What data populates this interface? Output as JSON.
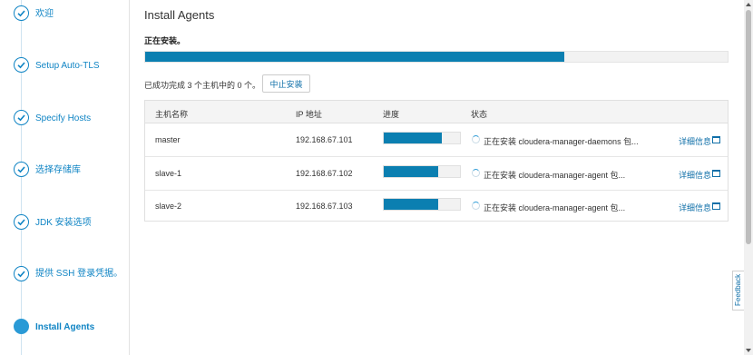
{
  "wizard": {
    "steps": [
      {
        "label": "欢迎",
        "state": "done"
      },
      {
        "label": "Setup Auto-TLS",
        "state": "done"
      },
      {
        "label": "Specify Hosts",
        "state": "done"
      },
      {
        "label": "选择存储库",
        "state": "done"
      },
      {
        "label": "JDK 安装选项",
        "state": "done"
      },
      {
        "label": "提供 SSH 登录凭据。",
        "state": "done"
      },
      {
        "label": "Install Agents",
        "state": "current"
      }
    ]
  },
  "main": {
    "title": "Install Agents",
    "status": "正在安装。",
    "overall_progress_fraction": 0.72,
    "summary": "已成功完成 3 个主机中的 0 个。",
    "abort_label": "中止安装"
  },
  "table": {
    "columns": [
      "主机名称",
      "IP 地址",
      "进度",
      "状态"
    ],
    "rows": [
      {
        "host": "master",
        "ip": "192.168.67.101",
        "progress_fraction": 0.76,
        "status": "正在安装 cloudera-manager-daemons 包...",
        "details": "详细信息"
      },
      {
        "host": "slave-1",
        "ip": "192.168.67.102",
        "progress_fraction": 0.72,
        "status": "正在安装 cloudera-manager-agent 包...",
        "details": "详细信息"
      },
      {
        "host": "slave-2",
        "ip": "192.168.67.103",
        "progress_fraction": 0.72,
        "status": "正在安装 cloudera-manager-agent 包...",
        "details": "详细信息"
      }
    ]
  },
  "feedback_label": "Feedback",
  "colors": {
    "accent": "#0b7fb1",
    "link": "#0f6fa8"
  }
}
